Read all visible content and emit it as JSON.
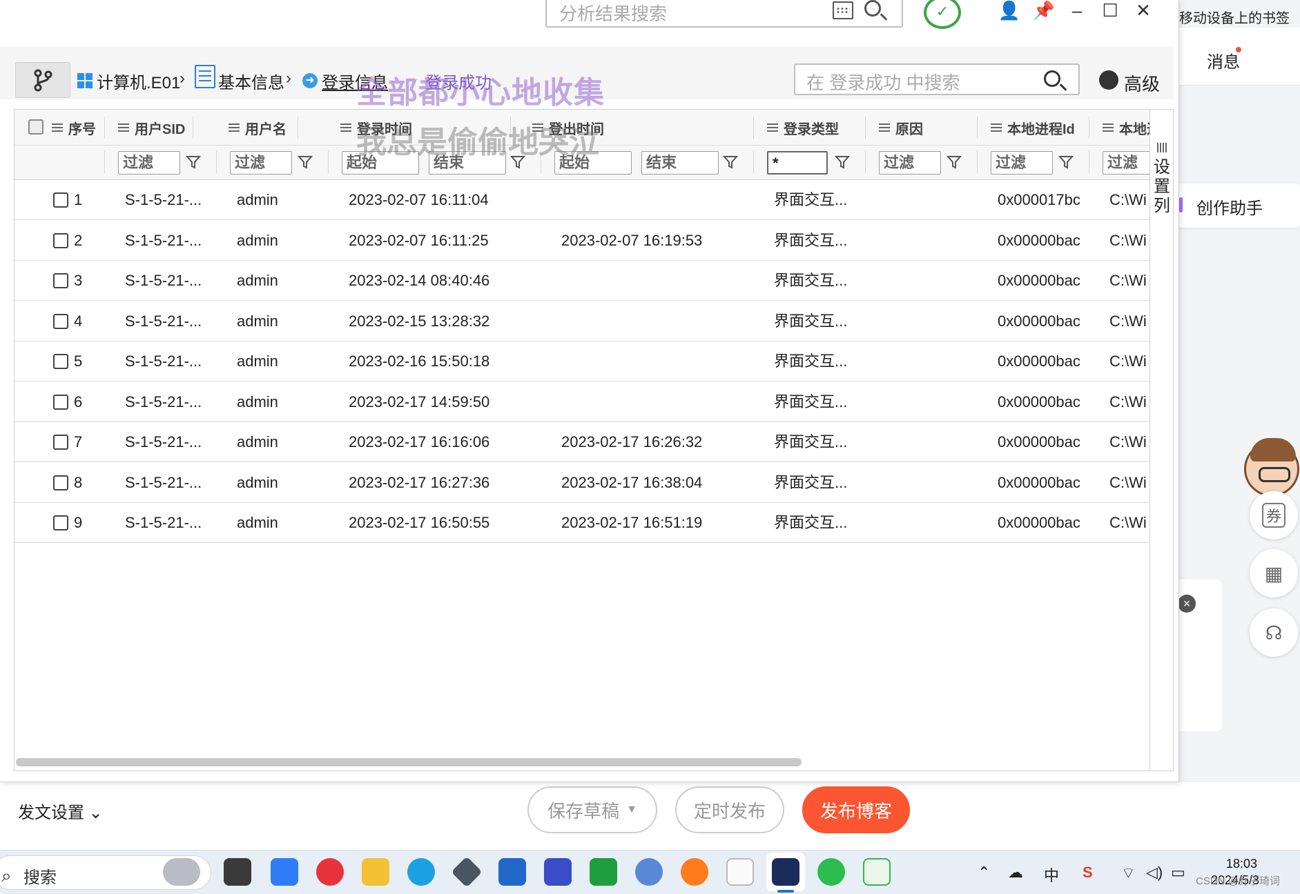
{
  "background": {
    "bookmarks_text": "移动设备上的书签",
    "messages_label": "消息",
    "assistant_label": "创作助手",
    "coupon_label": "券",
    "post_settings_label": "发文设置",
    "save_draft_label": "保存草稿",
    "schedule_label": "定时发布",
    "publish_label": "发布博客"
  },
  "taskbar": {
    "search_label": "搜索",
    "tray_ime": "中",
    "clock_time": "18:03",
    "clock_date": "2024/5/3",
    "credit": "CSDN @乔子琦词"
  },
  "window": {
    "search_placeholder": "分析结果搜索",
    "breadcrumb": [
      "计算机.E01",
      "基本信息",
      "登录信息",
      "登录成功"
    ],
    "watermark1": "全部都小心地收集",
    "watermark2": "我总是偷偷地哭泣",
    "crumb_search_placeholder": "在 登录成功 中搜索",
    "advanced_label": "高级",
    "column_settings_label": "设置列"
  },
  "table": {
    "columns": [
      "序号",
      "用户SID",
      "用户名",
      "登录时间",
      "登出时间",
      "登录类型",
      "原因",
      "本地进程Id",
      "本地进程"
    ],
    "filters": {
      "text": "过滤",
      "start": "起始",
      "end": "结束",
      "login_type": "*"
    },
    "rows": [
      {
        "no": "1",
        "sid": "S-1-5-21-...",
        "user": "admin",
        "login": "2023-02-07 16:11:04",
        "logout": "",
        "type": "界面交互...",
        "reason": "",
        "pid": "0x000017bc",
        "path": "C:\\Wi"
      },
      {
        "no": "2",
        "sid": "S-1-5-21-...",
        "user": "admin",
        "login": "2023-02-07 16:11:25",
        "logout": "2023-02-07 16:19:53",
        "type": "界面交互...",
        "reason": "",
        "pid": "0x00000bac",
        "path": "C:\\Wi"
      },
      {
        "no": "3",
        "sid": "S-1-5-21-...",
        "user": "admin",
        "login": "2023-02-14 08:40:46",
        "logout": "",
        "type": "界面交互...",
        "reason": "",
        "pid": "0x00000bac",
        "path": "C:\\Wi"
      },
      {
        "no": "4",
        "sid": "S-1-5-21-...",
        "user": "admin",
        "login": "2023-02-15 13:28:32",
        "logout": "",
        "type": "界面交互...",
        "reason": "",
        "pid": "0x00000bac",
        "path": "C:\\Wi"
      },
      {
        "no": "5",
        "sid": "S-1-5-21-...",
        "user": "admin",
        "login": "2023-02-16 15:50:18",
        "logout": "",
        "type": "界面交互...",
        "reason": "",
        "pid": "0x00000bac",
        "path": "C:\\Wi"
      },
      {
        "no": "6",
        "sid": "S-1-5-21-...",
        "user": "admin",
        "login": "2023-02-17 14:59:50",
        "logout": "",
        "type": "界面交互...",
        "reason": "",
        "pid": "0x00000bac",
        "path": "C:\\Wi"
      },
      {
        "no": "7",
        "sid": "S-1-5-21-...",
        "user": "admin",
        "login": "2023-02-17 16:16:06",
        "logout": "2023-02-17 16:26:32",
        "type": "界面交互...",
        "reason": "",
        "pid": "0x00000bac",
        "path": "C:\\Wi"
      },
      {
        "no": "8",
        "sid": "S-1-5-21-...",
        "user": "admin",
        "login": "2023-02-17 16:27:36",
        "logout": "2023-02-17 16:38:04",
        "type": "界面交互...",
        "reason": "",
        "pid": "0x00000bac",
        "path": "C:\\Wi"
      },
      {
        "no": "9",
        "sid": "S-1-5-21-...",
        "user": "admin",
        "login": "2023-02-17 16:50:55",
        "logout": "2023-02-17 16:51:19",
        "type": "界面交互...",
        "reason": "",
        "pid": "0x00000bac",
        "path": "C:\\Wi"
      }
    ]
  },
  "colors": {
    "accent_green": "#3ca448",
    "publish_red": "#fc5531",
    "link_blue": "#2b7fd8"
  }
}
